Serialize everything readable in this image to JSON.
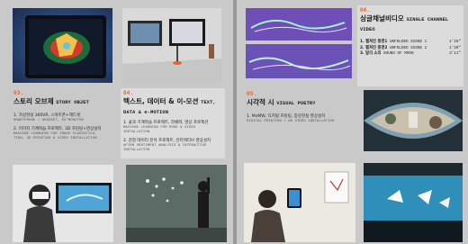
{
  "sections": {
    "s03": {
      "num": "03.",
      "title_ko": "스토리 오브제",
      "title_en": "STORY OBJET",
      "items": [
        {
          "ko": "1. 가상현실 360VR, 스마트폰+헤드셋",
          "en": "SMARTPHONE + HEADSET, 55\"MONITOR"
        },
        {
          "ko": "2. 이미지 기계학습 프로젝트, 3D 프린팅+영상설치",
          "en": "MACHINE LEARNING FOR IMAGE CLASSIFICA-\nTION, 3D PRINTING & VIDEO INSTALLATION"
        }
      ]
    },
    "s04": {
      "num": "04.",
      "title_ko": "텍스트, 데이터 & 이-모션",
      "title_en1": "TEXT,",
      "title_en2": "DATA & e-MOTION",
      "items": [
        {
          "ko": "1. 꽃과 기계학습 프로젝트, 라떼파, 영상 프로젝션",
          "en": "MACHINE LEARNING FOR ROSE & VIDEO\nINSTALLATION"
        },
        {
          "ko": "2. 감정 데이터 분석 프로젝트, 인터랙티브 영상설치",
          "en": "AFINN SENTIMENT ANALYSIS & INTERACTIVE\nINSTALLATION"
        }
      ]
    },
    "s05": {
      "num": "05.",
      "title_ko": "시각적 시",
      "title_en": "VISUAL POETRY",
      "items": [
        {
          "ko": "1. MoMW, 디지털 프린팅, 증강현실 영상설치",
          "en": "DIGITAL PRINTING + AR VIDEO INSTALLATION"
        }
      ]
    },
    "s06": {
      "num": "06.",
      "title_ko": "싱글채널비디오",
      "title_en": "SINGLE CHANNEL VIDEO",
      "rows": [
        {
          "ko": "1. 펼쳐진 풍경1",
          "en": "UNFOLDED SCENE 1",
          "dur": "1'25\""
        },
        {
          "ko": "2. 펼쳐진 풍경2",
          "en": "UNFOLDED SCENE 2",
          "dur": "1'20\""
        },
        {
          "ko": "3. 달의 소리",
          "en": "SOUND OF MOON",
          "dur": "3'11\""
        }
      ]
    }
  }
}
